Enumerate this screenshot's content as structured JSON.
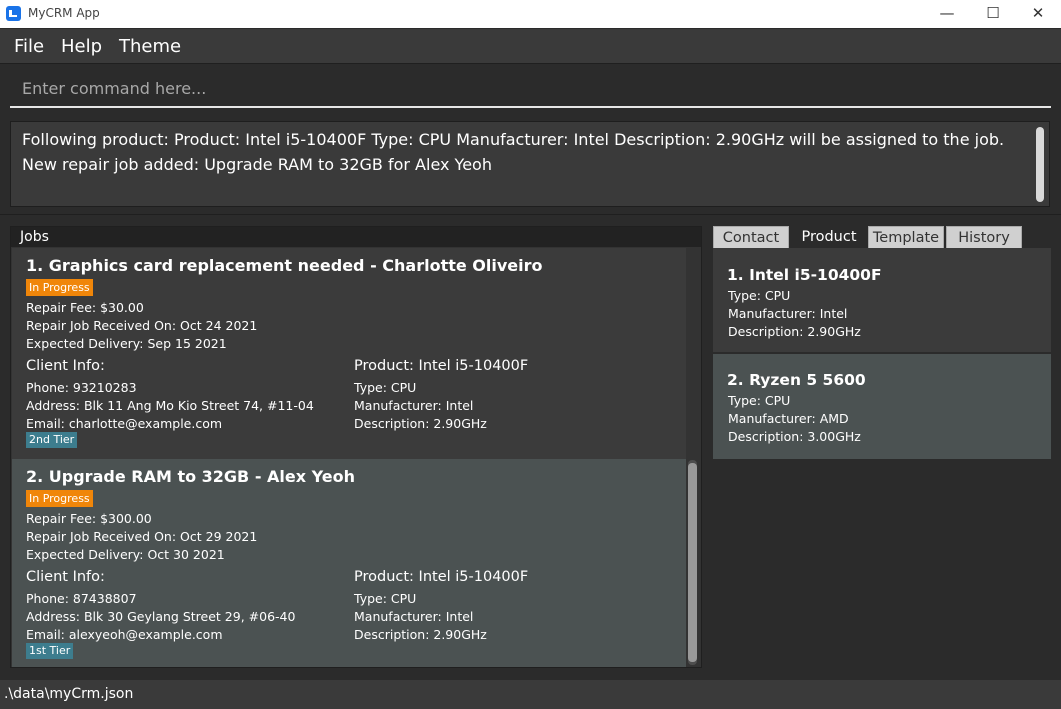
{
  "window": {
    "title": "MyCRM App",
    "minimize_glyph": "—",
    "maximize_glyph": "☐",
    "close_glyph": "✕"
  },
  "menu": {
    "file": "File",
    "help": "Help",
    "theme": "Theme"
  },
  "command": {
    "placeholder": "Enter command here...",
    "value": ""
  },
  "result": {
    "line1": "Following product: Product: Intel i5-10400F Type: CPU Manufacturer: Intel Description: 2.90GHz will be assigned to the job.",
    "line2": "New repair job added: Upgrade RAM to 32GB for Alex Yeoh"
  },
  "jobs": {
    "header": "Jobs",
    "items": [
      {
        "title": "1. Graphics card replacement needed - Charlotte Oliveiro",
        "status": "In Progress",
        "fee": "Repair Fee: $30.00",
        "received": "Repair Job Received On: Oct 24 2021",
        "delivery": "Expected Delivery: Sep 15 2021",
        "client_header": "Client Info:",
        "phone": "Phone: 93210283",
        "address": "Address: Blk 11 Ang Mo Kio Street 74, #11-04",
        "email": "Email: charlotte@example.com",
        "tier": "2nd Tier",
        "product_header": "Product: Intel i5-10400F",
        "type": "Type: CPU",
        "manufacturer": "Manufacturer: Intel",
        "description": "Description: 2.90GHz"
      },
      {
        "title": "2. Upgrade RAM to 32GB - Alex Yeoh",
        "status": "In Progress",
        "fee": "Repair Fee: $300.00",
        "received": "Repair Job Received On: Oct 29 2021",
        "delivery": "Expected Delivery: Oct 30 2021",
        "client_header": "Client Info:",
        "phone": "Phone: 87438807",
        "address": "Address: Blk 30 Geylang Street 29, #06-40",
        "email": "Email: alexyeoh@example.com",
        "tier": "1st Tier",
        "product_header": "Product: Intel i5-10400F",
        "type": "Type: CPU",
        "manufacturer": "Manufacturer: Intel",
        "description": "Description: 2.90GHz"
      }
    ]
  },
  "tabs": {
    "contact": "Contact",
    "product": "Product",
    "template": "Template",
    "history": "History",
    "selected": "Product"
  },
  "products": [
    {
      "title": "1.  Intel i5-10400F",
      "type": "Type: CPU",
      "manufacturer": "Manufacturer: Intel",
      "description": "Description: 2.90GHz"
    },
    {
      "title": "2.  Ryzen 5 5600",
      "type": "Type: CPU",
      "manufacturer": "Manufacturer: AMD",
      "description": "Description: 3.00GHz"
    }
  ],
  "status": {
    "path": ".\\data\\myCrm.json"
  },
  "colors": {
    "in_progress": "#f0860a",
    "tier_badge": "#3d7d8e",
    "app_icon": "#1a73e8"
  }
}
